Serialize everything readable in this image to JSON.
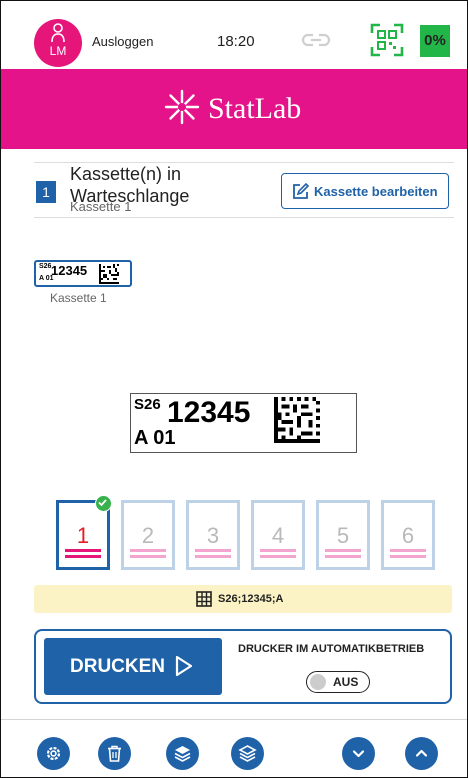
{
  "topbar": {
    "user_initials": "LM",
    "logout_label": "Ausloggen",
    "time": "18:20",
    "battery_label": "0%",
    "battery_color": "#22b548"
  },
  "header": {
    "brand_name": "StatLab",
    "brand_color": "#e5138a"
  },
  "queue": {
    "count": "1",
    "title": "Kassette(n) in Warteschlange",
    "subtitle": "Kassette 1",
    "edit_button_label": "Kassette bearbeiten"
  },
  "thumbnail": {
    "prefix": "S26",
    "number": "12345",
    "sub": "A 01",
    "caption": "Kassette 1"
  },
  "label_preview": {
    "prefix": "S26",
    "number": "12345",
    "sub": "A 01"
  },
  "slots": [
    {
      "number": "1",
      "active": true,
      "checked": true
    },
    {
      "number": "2",
      "active": false
    },
    {
      "number": "3",
      "active": false
    },
    {
      "number": "4",
      "active": false
    },
    {
      "number": "5",
      "active": false
    },
    {
      "number": "6",
      "active": false
    }
  ],
  "barcode_text": "S26;12345;A",
  "print": {
    "button_label": "DRUCKEN",
    "auto_label": "DRUCKER IM AUTOMATIKBETRIEB",
    "toggle_label": "AUS"
  },
  "toolbar": {
    "icons": [
      "gear-icon",
      "trash-icon",
      "layers-icon",
      "layers-outline-icon",
      "chevron-down-icon",
      "chevron-up-icon"
    ]
  },
  "colors": {
    "accent": "#1f62a8",
    "active_slot_number": "#e41e26",
    "tray": "#e5157a",
    "barcode_bar": "#fbf3c5"
  }
}
